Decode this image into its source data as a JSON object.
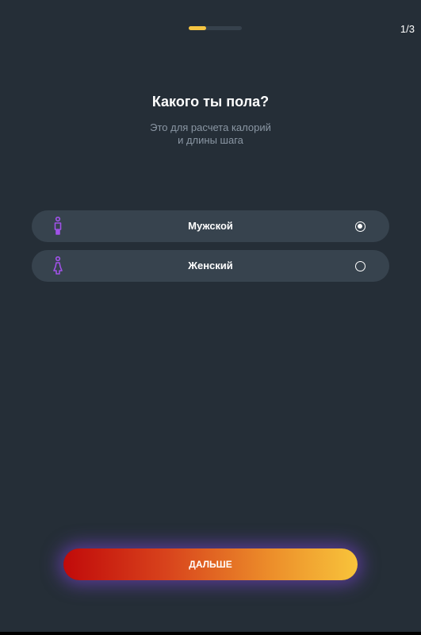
{
  "progress": {
    "step": 1,
    "total": 3,
    "counter_text": "1/3",
    "fill_fraction": 0.33,
    "fill_color": "#f5c542",
    "track_color": "#36414c"
  },
  "question": {
    "title": "Какого ты пола?",
    "subtitle_line1": "Это для расчета калорий",
    "subtitle_line2": "и длины шага"
  },
  "options": [
    {
      "label": "Мужской",
      "icon": "male-person-icon",
      "selected": true
    },
    {
      "label": "Женский",
      "icon": "female-person-icon",
      "selected": false
    }
  ],
  "icon_color": "#a052e8",
  "next_button": {
    "label": "ДАЛЬШЕ"
  }
}
